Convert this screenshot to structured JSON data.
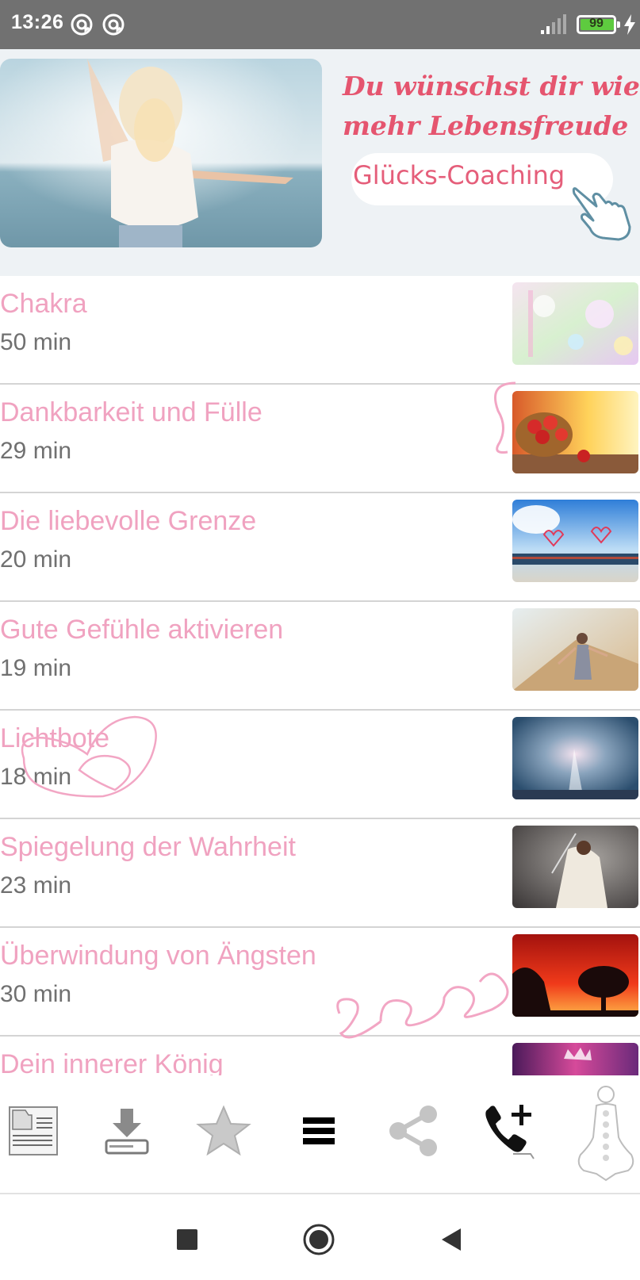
{
  "status_bar": {
    "time": "13:26",
    "battery_level": "99",
    "icons": [
      "sync-icon",
      "sync-icon",
      "signal-icon",
      "battery-icon",
      "charging-icon"
    ]
  },
  "banner": {
    "headline_line1": "Du wünschst dir wieder",
    "headline_line2": "mehr Lebensfreude ?",
    "cta_label": "Glücks-Coaching",
    "accent_color": "#e5556f"
  },
  "meditations": [
    {
      "title": "Chakra",
      "duration": "50 min"
    },
    {
      "title": "Dankbarkeit und Fülle",
      "duration": "29 min"
    },
    {
      "title": "Die liebevolle Grenze",
      "duration": "20 min"
    },
    {
      "title": "Gute Gefühle aktivieren",
      "duration": "19 min"
    },
    {
      "title": "Lichtbote",
      "duration": "18 min"
    },
    {
      "title": "Spiegelung der Wahrheit",
      "duration": "23 min"
    },
    {
      "title": "Überwindung von Ängsten",
      "duration": "30 min"
    },
    {
      "title": "Dein innerer König",
      "duration": ""
    }
  ],
  "toolbar": {
    "items": [
      "document-icon",
      "download-icon",
      "star-icon",
      "menu-icon",
      "share-icon",
      "add-call-icon",
      "chakra-body-icon"
    ]
  },
  "navigation_bar": {
    "items": [
      "recents-icon",
      "home-icon",
      "back-icon"
    ]
  },
  "colors": {
    "title_pink": "#f0a2c0",
    "duration_gray": "#707070",
    "status_bar_gray": "#717171"
  }
}
